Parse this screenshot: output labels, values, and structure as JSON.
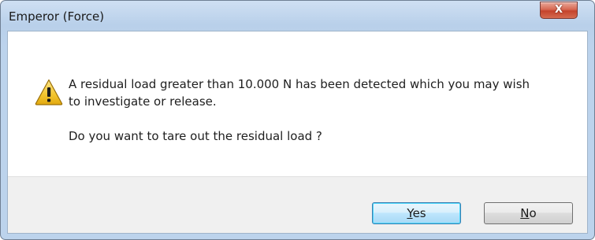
{
  "window": {
    "title": "Emperor (Force)",
    "close_glyph": "X"
  },
  "message": {
    "icon": "warning-icon",
    "line1": "A residual load greater than 10.000 N has been detected which you may wish to investigate or release.",
    "line2": "Do you want to tare out the residual load ?"
  },
  "buttons": {
    "yes_first": "Y",
    "yes_rest": "es",
    "no_first": "N",
    "no_rest": "o"
  },
  "colors": {
    "title_bar": "#bcd3ec",
    "close_button": "#c4432c",
    "button_bar": "#f0f0f0",
    "default_button_border": "#3c7fb1",
    "warning_fill": "#f3c52e"
  }
}
